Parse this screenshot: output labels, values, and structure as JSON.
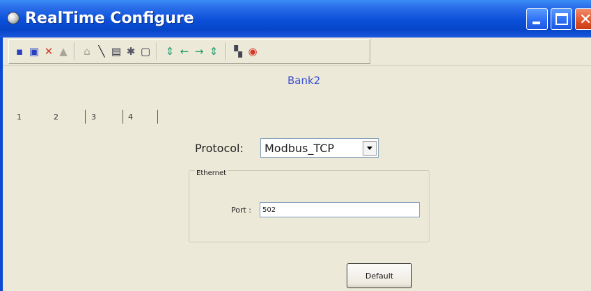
{
  "window": {
    "title": "RealTime Configure"
  },
  "toolbar": {
    "buttons": [
      {
        "name": "save",
        "glyph": "▪",
        "color": "#2a3fbf"
      },
      {
        "name": "window",
        "glyph": "▣",
        "color": "#2a3fbf"
      },
      {
        "name": "delete",
        "glyph": "✕",
        "color": "#d23a2a"
      },
      {
        "name": "print",
        "glyph": "▲",
        "color": "#a8a49a"
      },
      {
        "name": "bell",
        "glyph": "⌂",
        "color": "#a8a49a"
      },
      {
        "name": "line",
        "glyph": "╲",
        "color": "#223"
      },
      {
        "name": "document",
        "glyph": "▤",
        "color": "#334"
      },
      {
        "name": "tools",
        "glyph": "✱",
        "color": "#556"
      },
      {
        "name": "page",
        "glyph": "▢",
        "color": "#334"
      },
      {
        "name": "align-both",
        "glyph": "⇕",
        "color": "#1a9a6a"
      },
      {
        "name": "arrow-left",
        "glyph": "←",
        "color": "#1a9a6a"
      },
      {
        "name": "arrow-right",
        "glyph": "→",
        "color": "#1a9a6a"
      },
      {
        "name": "align-both-2",
        "glyph": "⇕",
        "color": "#1a9a6a"
      },
      {
        "name": "network",
        "glyph": "▚",
        "color": "#445"
      },
      {
        "name": "stop",
        "glyph": "◉",
        "color": "#d23a2a"
      }
    ]
  },
  "content": {
    "bank_title": "Bank2",
    "tabs": [
      "1",
      "2",
      "3",
      "4"
    ],
    "protocol": {
      "label": "Protocol:",
      "value": "Modbus_TCP"
    },
    "ethernet": {
      "legend": "Ethernet",
      "port_label": "Port :",
      "port_value": "502"
    },
    "default_label": "Default"
  }
}
